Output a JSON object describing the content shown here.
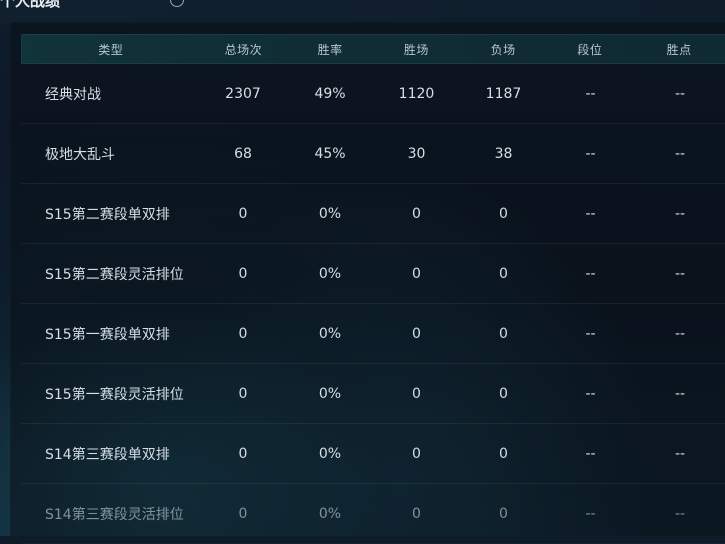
{
  "header": {
    "title_fragment": "个人战绩"
  },
  "table": {
    "headers": [
      "类型",
      "总场次",
      "胜率",
      "胜场",
      "负场",
      "段位",
      "胜点"
    ],
    "rows": [
      {
        "type": "经典对战",
        "total": "2307",
        "win_rate": "49%",
        "wins": "1120",
        "losses": "1187",
        "rank": "--",
        "lp": "--"
      },
      {
        "type": "极地大乱斗",
        "total": "68",
        "win_rate": "45%",
        "wins": "30",
        "losses": "38",
        "rank": "--",
        "lp": "--"
      },
      {
        "type": "S15第二赛段单双排",
        "total": "0",
        "win_rate": "0%",
        "wins": "0",
        "losses": "0",
        "rank": "--",
        "lp": "--"
      },
      {
        "type": "S15第二赛段灵活排位",
        "total": "0",
        "win_rate": "0%",
        "wins": "0",
        "losses": "0",
        "rank": "--",
        "lp": "--"
      },
      {
        "type": "S15第一赛段单双排",
        "total": "0",
        "win_rate": "0%",
        "wins": "0",
        "losses": "0",
        "rank": "--",
        "lp": "--"
      },
      {
        "type": "S15第一赛段灵活排位",
        "total": "0",
        "win_rate": "0%",
        "wins": "0",
        "losses": "0",
        "rank": "--",
        "lp": "--"
      },
      {
        "type": "S14第三赛段单双排",
        "total": "0",
        "win_rate": "0%",
        "wins": "0",
        "losses": "0",
        "rank": "--",
        "lp": "--"
      },
      {
        "type": "S14第三赛段灵活排位",
        "total": "0",
        "win_rate": "0%",
        "wins": "0",
        "losses": "0",
        "rank": "--",
        "lp": "--"
      }
    ]
  },
  "icons": {
    "info": "info-circle-icon"
  }
}
